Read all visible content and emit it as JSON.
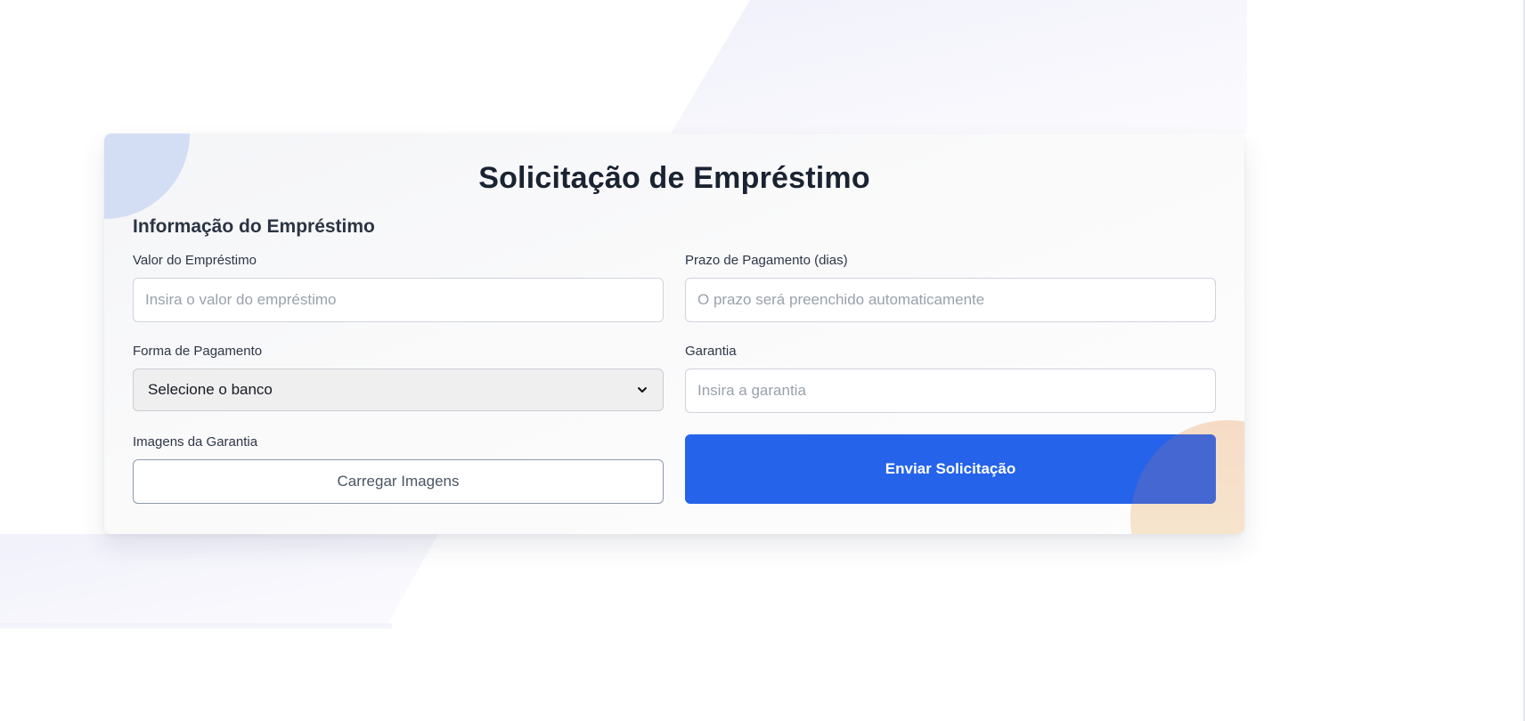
{
  "page": {
    "title": "Solicitação de Empréstimo",
    "section_title": "Informação do Empréstimo"
  },
  "form": {
    "loan_amount": {
      "label": "Valor do Empréstimo",
      "value": "",
      "placeholder": "Insira o valor do empréstimo"
    },
    "payment_term": {
      "label": "Prazo de Pagamento (dias)",
      "value": "",
      "placeholder": "O prazo será preenchido automaticamente"
    },
    "payment_method": {
      "label": "Forma de Pagamento",
      "selected": "Selecione o banco"
    },
    "collateral": {
      "label": "Garantia",
      "value": "",
      "placeholder": "Insira a garantia"
    },
    "collateral_images": {
      "label": "Imagens da Garantia",
      "button_label": "Carregar Imagens"
    },
    "submit": {
      "label": "Enviar Solicitação"
    }
  },
  "icons": {
    "select_indicator": "chevron-down-icon"
  },
  "colors": {
    "primary": "#2563eb",
    "title": "#1a2332",
    "accent_blob_blue": "#d3def5",
    "accent_blob_peach": "#f6dcc6"
  }
}
